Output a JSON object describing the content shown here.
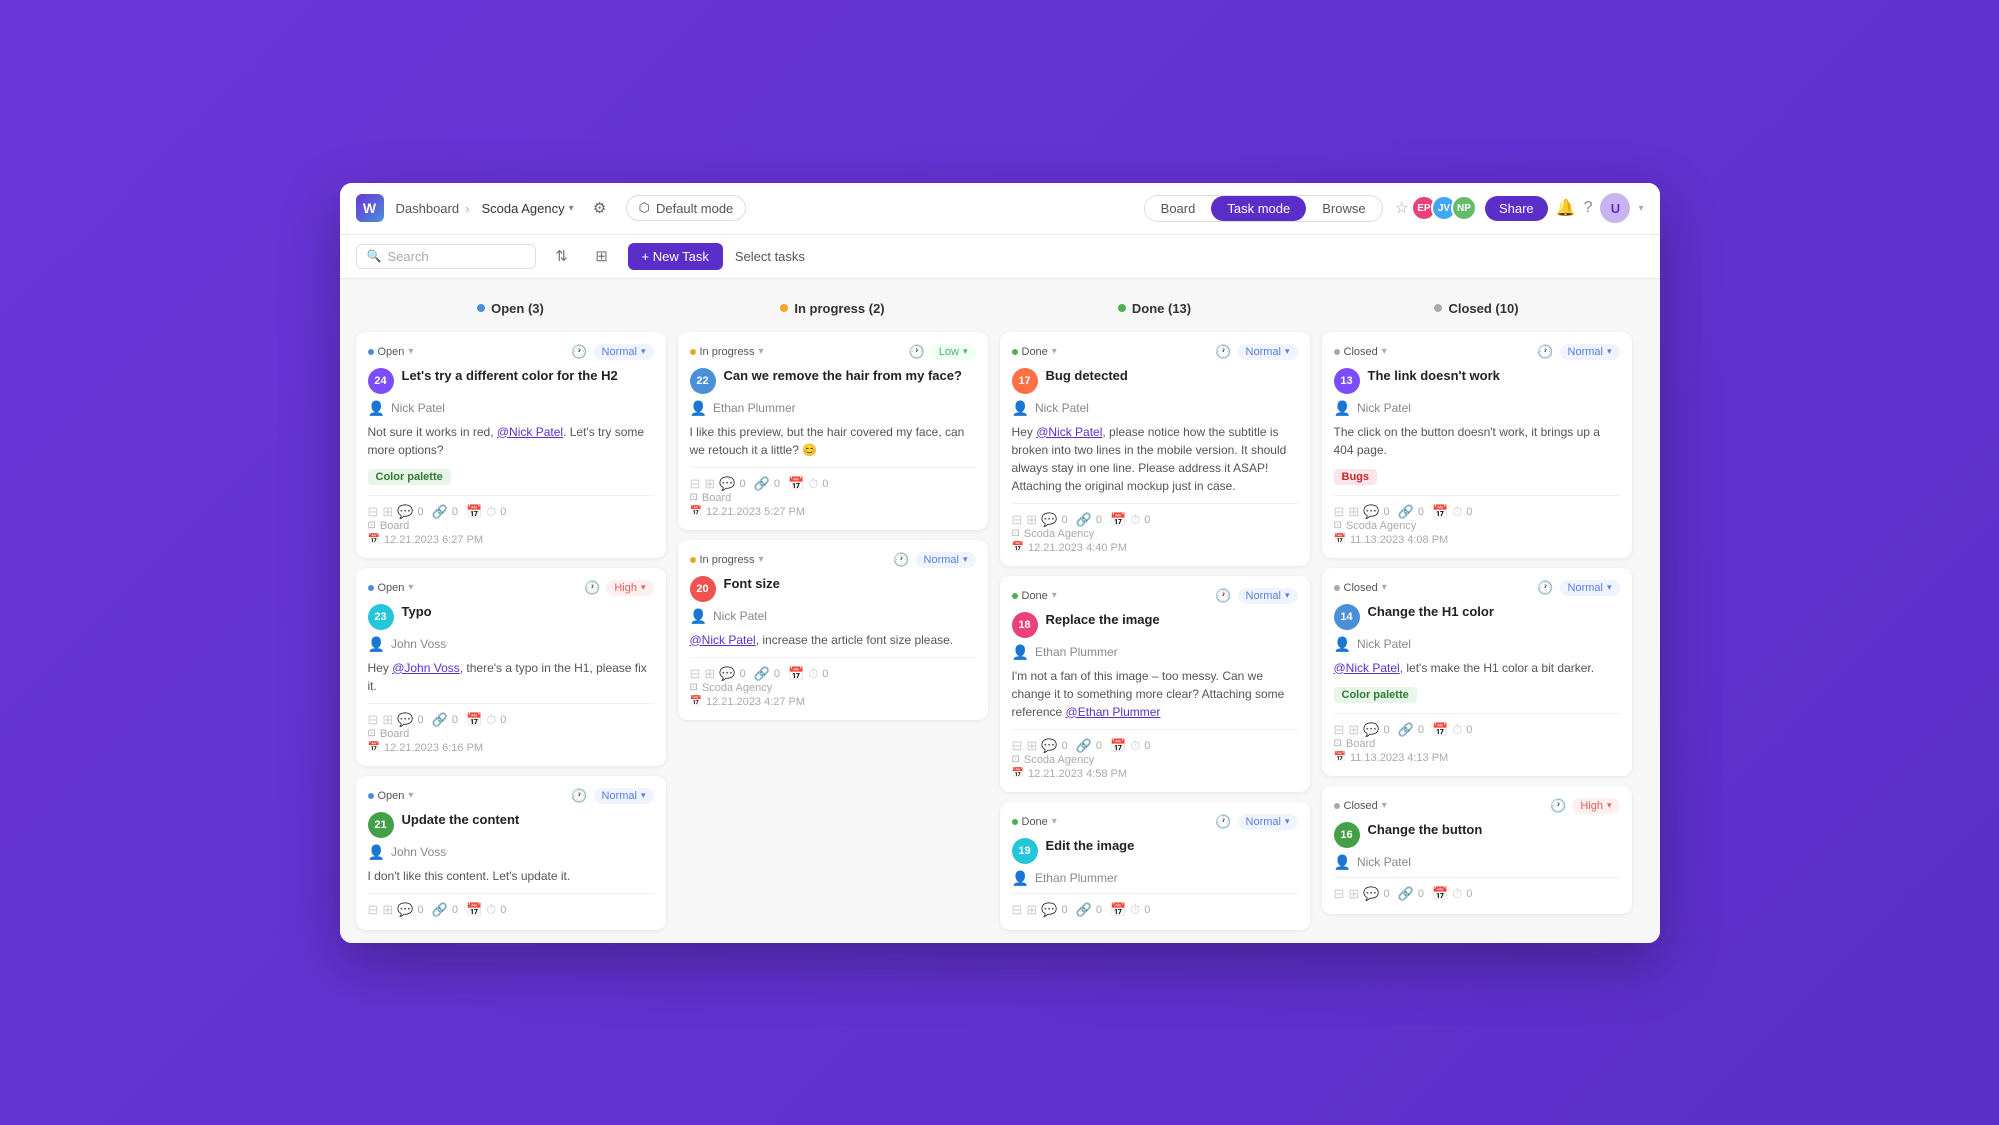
{
  "app": {
    "logo": "W",
    "breadcrumb_home": "Dashboard",
    "breadcrumb_sep": "›",
    "breadcrumb_current": "Scoda Agency",
    "mode_label": "Default mode",
    "views": [
      "Board",
      "Task mode",
      "Browse"
    ],
    "active_view": "Task mode",
    "new_task_label": "+ New Task",
    "select_tasks_label": "Select tasks",
    "search_placeholder": "Search"
  },
  "columns": [
    {
      "id": "open",
      "dot": "blue",
      "label": "Open (3)",
      "cards": [
        {
          "id": "card-24",
          "num": "24",
          "num_color": "num-purple",
          "status": "Open",
          "status_dot": "blue",
          "priority": "Normal",
          "priority_class": "priority-normal",
          "title": "Let's try a different color for the H2",
          "assignee": "Nick Patel",
          "body": "Not sure it works in red, @Nick Patel. Let's try some more options?",
          "mention": "@Nick Patel",
          "tag": "Color palette",
          "tag_class": "tag-color",
          "board": "Board",
          "date": "12.21.2023 6:27 PM",
          "comments": "0"
        },
        {
          "id": "card-23",
          "num": "23",
          "num_color": "num-teal",
          "status": "Open",
          "status_dot": "blue",
          "priority": "High",
          "priority_class": "priority-high",
          "title": "Typo",
          "assignee": "John Voss",
          "body": "Hey @John Voss, there's a typo in the H1, please fix it.",
          "mention": "@John Voss",
          "tag": "",
          "board": "Board",
          "date": "12.21.2023 6:16 PM",
          "comments": "0"
        },
        {
          "id": "card-21",
          "num": "21",
          "num_color": "num-green",
          "status": "Open",
          "status_dot": "blue",
          "priority": "Normal",
          "priority_class": "priority-normal",
          "title": "Update the content",
          "assignee": "John Voss",
          "body": "I don't like this content. Let's update it.",
          "mention": "",
          "tag": "",
          "board": "",
          "date": "",
          "comments": "0"
        }
      ]
    },
    {
      "id": "inprogress",
      "dot": "orange",
      "label": "In progress (2)",
      "cards": [
        {
          "id": "card-22",
          "num": "22",
          "num_color": "num-blue",
          "status": "In progress",
          "status_dot": "orange",
          "priority": "Low",
          "priority_class": "priority-low",
          "title": "Can we remove the hair from my face?",
          "assignee": "Ethan Plummer",
          "body": "I like this preview, but the hair covered my face, can we retouch it a little? 😊",
          "mention": "",
          "tag": "",
          "board": "Board",
          "date": "12.21.2023 5:27 PM",
          "comments": "0"
        },
        {
          "id": "card-20",
          "num": "20",
          "num_color": "num-red",
          "status": "In progress",
          "status_dot": "orange",
          "priority": "Normal",
          "priority_class": "priority-normal",
          "title": "Font size",
          "assignee": "Nick Patel",
          "body": "@Nick Patel, increase the article font size please.",
          "mention": "@Nick Patel",
          "tag": "",
          "board": "Scoda Agency",
          "date": "12.21.2023 4:27 PM",
          "comments": "0"
        }
      ]
    },
    {
      "id": "done",
      "dot": "green",
      "label": "Done (13)",
      "cards": [
        {
          "id": "card-17",
          "num": "17",
          "num_color": "num-orange",
          "status": "Done",
          "status_dot": "green",
          "priority": "Normal",
          "priority_class": "priority-normal",
          "title": "Bug detected",
          "assignee": "Nick Patel",
          "body": "Hey @Nick Patel, please notice how the subtitle is broken into two lines in the mobile version. It should always stay in one line. Please address it ASAP! Attaching the original mockup just in case.",
          "mention": "@Nick Patel",
          "tag": "",
          "board": "Scoda Agency",
          "date": "12.21.2023 4:40 PM",
          "comments": "0"
        },
        {
          "id": "card-18",
          "num": "18",
          "num_color": "num-pink",
          "status": "Done",
          "status_dot": "green",
          "priority": "Normal",
          "priority_class": "priority-normal",
          "title": "Replace the image",
          "assignee": "Ethan Plummer",
          "body": "I'm not a fan of this image – too messy. Can we change it to something more clear? Attaching some reference @Ethan Plummer",
          "mention": "@Ethan Plummer",
          "tag": "",
          "board": "Scoda Agency",
          "date": "12.21.2023 4:58 PM",
          "comments": "0"
        },
        {
          "id": "card-19",
          "num": "19",
          "num_color": "num-teal",
          "status": "Done",
          "status_dot": "green",
          "priority": "Normal",
          "priority_class": "priority-normal",
          "title": "Edit the image",
          "assignee": "Ethan Plummer",
          "body": "",
          "mention": "",
          "tag": "",
          "board": "",
          "date": "",
          "comments": "0"
        }
      ]
    },
    {
      "id": "closed",
      "dot": "gray",
      "label": "Closed (10)",
      "cards": [
        {
          "id": "card-13",
          "num": "13",
          "num_color": "num-purple",
          "status": "Closed",
          "status_dot": "gray",
          "priority": "Normal",
          "priority_class": "priority-normal",
          "title": "The link doesn't work",
          "assignee": "Nick Patel",
          "body": "The click on the button doesn't work, it brings up a 404 page.",
          "mention": "",
          "tag": "Bugs",
          "tag_class": "tag-bugs",
          "board": "Scoda Agency",
          "date": "11.13.2023 4:08 PM",
          "comments": "0"
        },
        {
          "id": "card-14",
          "num": "14",
          "num_color": "num-blue",
          "status": "Closed",
          "status_dot": "gray",
          "priority": "Normal",
          "priority_class": "priority-normal",
          "title": "Change the H1 color",
          "assignee": "Nick Patel",
          "body": "@Nick Patel, let's make the H1 color a bit darker.",
          "mention": "@Nick Patel",
          "tag": "Color palette",
          "tag_class": "tag-color",
          "board": "Board",
          "date": "11.13.2023 4:13 PM",
          "comments": "0"
        },
        {
          "id": "card-16",
          "num": "16",
          "num_color": "num-green",
          "status": "Closed",
          "status_dot": "gray",
          "priority": "High",
          "priority_class": "priority-high",
          "title": "Change the button",
          "assignee": "Nick Patel",
          "body": "",
          "mention": "",
          "tag": "",
          "board": "",
          "date": "",
          "comments": "0"
        }
      ]
    }
  ]
}
